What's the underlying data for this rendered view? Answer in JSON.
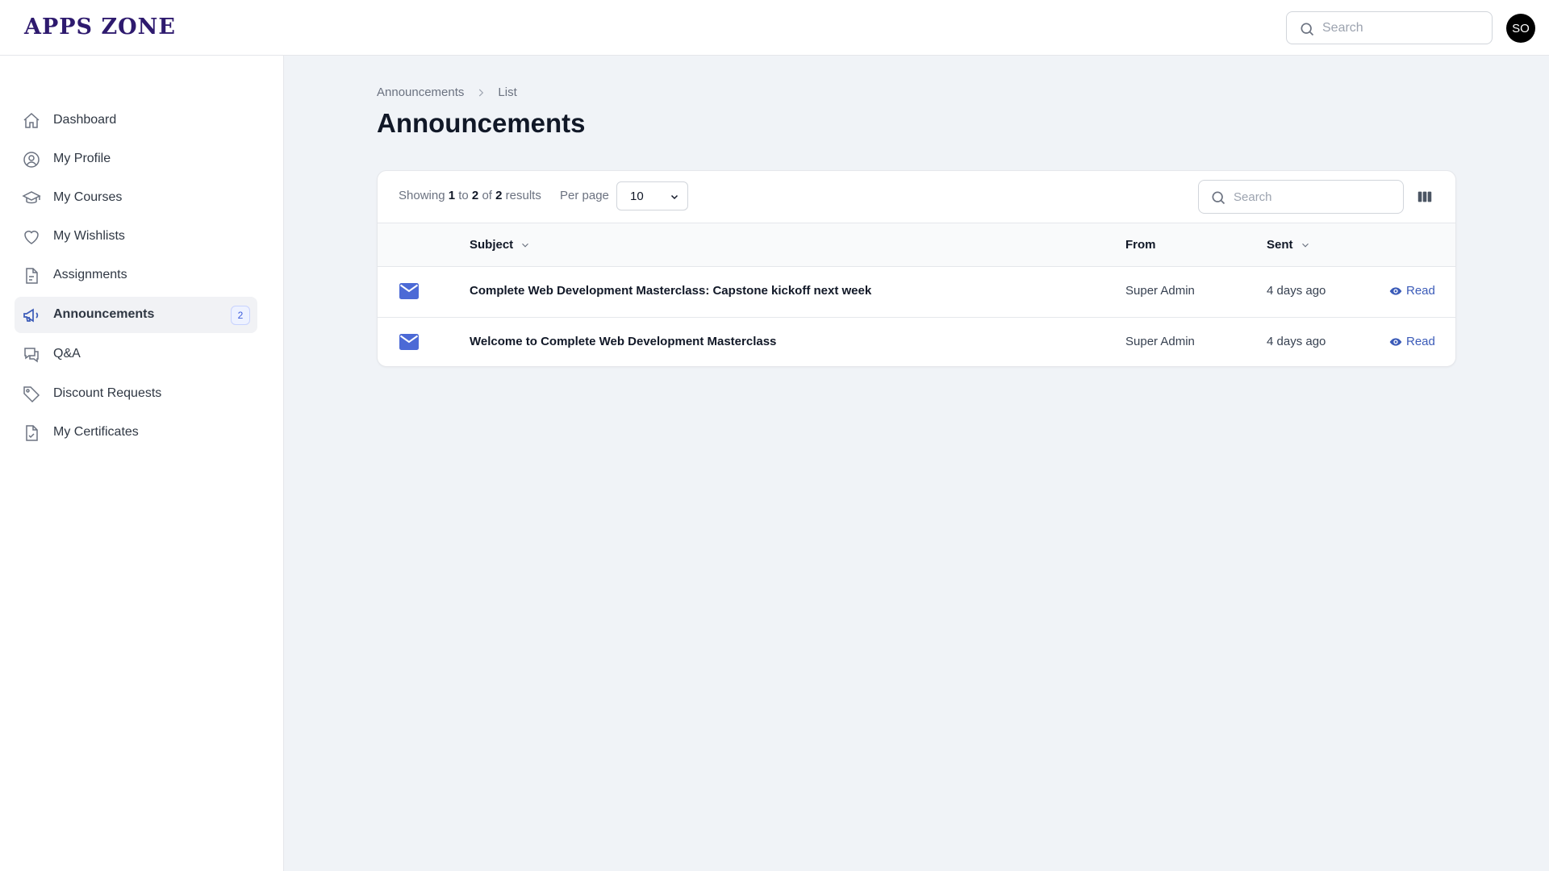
{
  "app": {
    "logo_text": "APPS ZONE",
    "avatar_initials": "SO",
    "search_placeholder": "Search"
  },
  "sidebar": {
    "items": [
      {
        "label": "Dashboard",
        "icon": "home-icon"
      },
      {
        "label": "My Profile",
        "icon": "user-circle-icon"
      },
      {
        "label": "My Courses",
        "icon": "graduation-cap-icon"
      },
      {
        "label": "My Wishlists",
        "icon": "heart-icon"
      },
      {
        "label": "Assignments",
        "icon": "document-icon"
      },
      {
        "label": "Announcements",
        "icon": "megaphone-icon",
        "badge": "2",
        "active": true
      },
      {
        "label": "Q&A",
        "icon": "chat-bubbles-icon"
      },
      {
        "label": "Discount Requests",
        "icon": "tag-icon"
      },
      {
        "label": "My Certificates",
        "icon": "document-check-icon"
      }
    ]
  },
  "breadcrumb": {
    "parent": "Announcements",
    "current": "List"
  },
  "page": {
    "title": "Announcements"
  },
  "table": {
    "showing": {
      "prefix": "Showing",
      "from": "1",
      "to_word": "to",
      "to": "2",
      "of_word": "of",
      "total": "2",
      "suffix": "results"
    },
    "per_page_label": "Per page",
    "per_page_value": "10",
    "search_placeholder": "Search",
    "columns": {
      "subject": "Subject",
      "from": "From",
      "sent": "Sent"
    },
    "rows": [
      {
        "subject": "Complete Web Development Masterclass: Capstone kickoff next week",
        "from": "Super Admin",
        "sent": "4 days ago",
        "action": "Read"
      },
      {
        "subject": "Welcome to Complete Web Development Masterclass",
        "from": "Super Admin",
        "sent": "4 days ago",
        "action": "Read"
      }
    ]
  },
  "colors": {
    "accent": "#3b5bb8",
    "mail_icon": "#4c6ad6",
    "logo": "#2e1a6e"
  }
}
